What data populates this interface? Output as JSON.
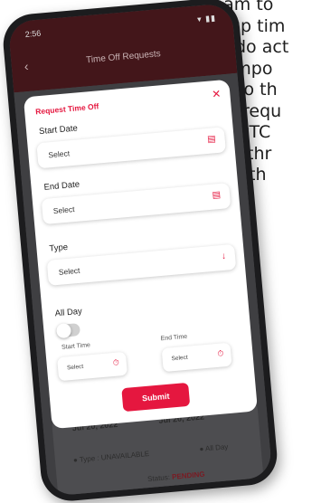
{
  "promo": {
    "lines": [
      "team to",
      "up tim",
      "do act",
      "impo",
      "to th",
      "requ",
      "PTC",
      "thr",
      "th"
    ]
  },
  "status_bar": {
    "time": "2:56",
    "signal": "▾ ▮▮"
  },
  "header": {
    "title": "Time Off Requests",
    "back_icon": "back-arrow-icon"
  },
  "background_card": {
    "start_date": "Jul 20, 2022",
    "end_date": "Jul 20, 2022",
    "type": "Type : UNAVAILABLE",
    "all_day": "All Day",
    "status_label": "Status:",
    "status_value": "PENDING"
  },
  "modal": {
    "title": "Request Time Off",
    "start_date": {
      "label": "Start Date",
      "value": "Select",
      "icon": "calendar-icon"
    },
    "end_date": {
      "label": "End Date",
      "value": "Select",
      "icon": "calendar-icon"
    },
    "type": {
      "label": "Type",
      "value": "Select",
      "icon": "chevron-down-icon"
    },
    "all_day": {
      "label": "All Day",
      "on": false
    },
    "start_time": {
      "label": "Start Time",
      "value": "Select",
      "icon": "clock-icon"
    },
    "end_time": {
      "label": "End Time",
      "value": "Select",
      "icon": "clock-icon"
    },
    "submit_label": "Submit"
  },
  "colors": {
    "accent": "#e5173f",
    "header": "#43161a",
    "overlay": "#3f3f42"
  }
}
